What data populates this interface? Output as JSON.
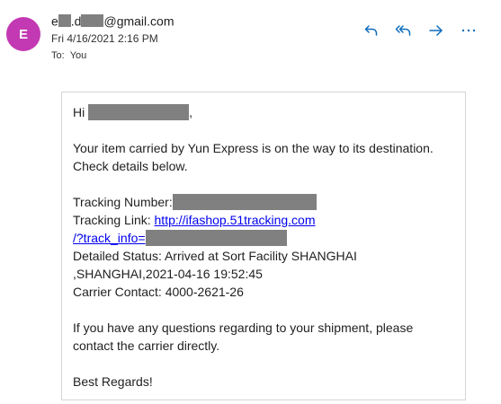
{
  "header": {
    "avatar_letter": "E",
    "sender_prefix": "e",
    "sender_mid": ".d",
    "sender_domain": "@gmail.com",
    "date": "Fri 4/16/2021 2:16 PM",
    "to_label": "To:",
    "to_value": "You"
  },
  "actions": {
    "reply_icon": "reply-icon",
    "reply_all_icon": "reply-all-icon",
    "forward_icon": "forward-icon",
    "more_icon": "more-icon"
  },
  "message": {
    "greeting": "Hi",
    "greeting_end": ",",
    "intro_line1": "Your item carried by Yun Express is on the way to its destination.",
    "intro_line2": "Check details below.",
    "tracking_number_label": "Tracking Number:",
    "tracking_link_label": "Tracking Link:",
    "tracking_link_part1": "http://ifashop.51tracking.com",
    "tracking_link_part2": "/?track_info=",
    "status_line1": "Detailed Status: Arrived at Sort Facility SHANGHAI",
    "status_line2": ",SHANGHAI,2021-04-16 19:52:45",
    "carrier_contact": "Carrier Contact: 4000-2621-26",
    "questions_line1": "If you have any questions regarding to your shipment, please",
    "questions_line2": "contact the carrier directly.",
    "closing": "Best Regards!"
  },
  "colors": {
    "avatar_bg": "#c239b3",
    "action_icon": "#0f6cbd",
    "redaction": "#808080",
    "link": "#0000ee"
  }
}
